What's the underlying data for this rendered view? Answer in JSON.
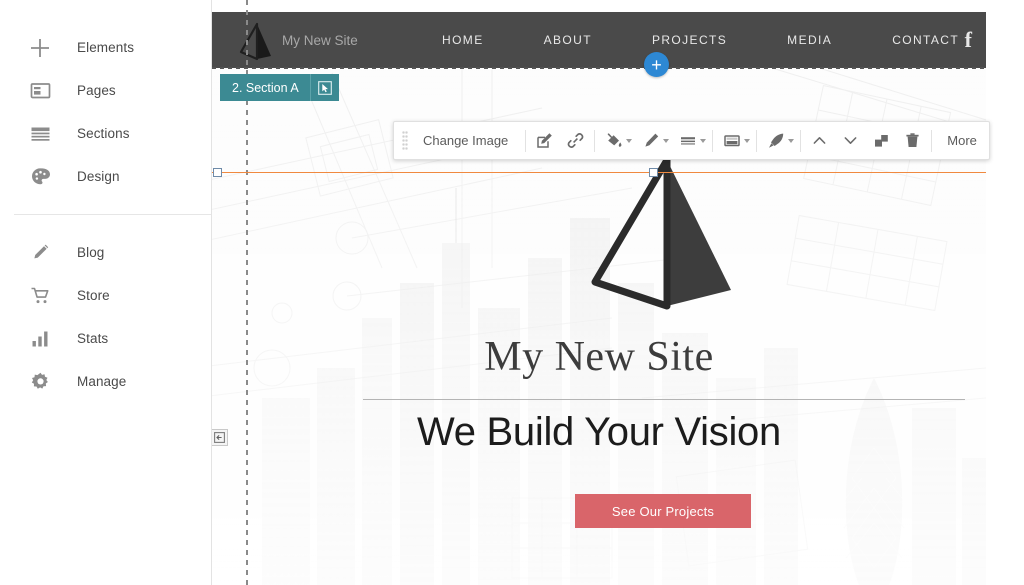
{
  "sidebar": {
    "groups": [
      {
        "items": [
          {
            "label": "Elements",
            "icon": "plus-icon"
          },
          {
            "label": "Pages",
            "icon": "pages-icon"
          },
          {
            "label": "Sections",
            "icon": "sections-icon"
          },
          {
            "label": "Design",
            "icon": "palette-icon"
          }
        ]
      },
      {
        "items": [
          {
            "label": "Blog",
            "icon": "pencil-icon"
          },
          {
            "label": "Store",
            "icon": "cart-icon"
          },
          {
            "label": "Stats",
            "icon": "bar-chart-icon"
          },
          {
            "label": "Manage",
            "icon": "gear-icon"
          }
        ]
      }
    ]
  },
  "toolbar": {
    "grip": "drag-grip",
    "change_image_label": "Change Image",
    "more_label": "More",
    "buttons": [
      {
        "name": "edit-image-button",
        "icon": "edit-square-icon",
        "caret": false
      },
      {
        "name": "link-button",
        "icon": "link-icon",
        "caret": false
      },
      {
        "name": "fill-color-button",
        "icon": "paint-bucket-icon",
        "caret": true
      },
      {
        "name": "pen-color-button",
        "icon": "pen-icon",
        "caret": true
      },
      {
        "name": "border-style-button",
        "icon": "lines-icon",
        "caret": true
      },
      {
        "name": "shadow-button",
        "icon": "shadow-icon",
        "caret": true
      },
      {
        "name": "animation-button",
        "icon": "rocket-icon",
        "caret": true
      },
      {
        "name": "move-up-button",
        "icon": "chevron-up-icon",
        "caret": false
      },
      {
        "name": "move-down-button",
        "icon": "chevron-down-icon",
        "caret": false
      },
      {
        "name": "duplicate-button",
        "icon": "duplicate-icon",
        "caret": false
      },
      {
        "name": "delete-button",
        "icon": "trash-icon",
        "caret": false
      }
    ]
  },
  "canvas": {
    "section_badge": {
      "label": "2. Section A",
      "select_icon": "select-cursor-icon",
      "color": "#3c8a93"
    },
    "add_section_button": {
      "label": "+",
      "color": "#2d88d4"
    },
    "collapse_button": {
      "icon": "collapse-left-icon"
    },
    "guide_color": "#f0893f"
  },
  "site": {
    "logo_icon": "pyramid-logo-icon",
    "title": "My New Site",
    "menu": [
      "HOME",
      "ABOUT",
      "PROJECTS",
      "MEDIA",
      "CONTACT"
    ],
    "social_icon": "facebook-icon",
    "nav_bg": "#4a4a4a"
  },
  "hero": {
    "logo_icon": "pyramid-logo-large-icon",
    "title": "My New Site",
    "subtitle": "We Build Your Vision",
    "cta_label": "See Our Projects",
    "cta_color": "#d9656a"
  }
}
